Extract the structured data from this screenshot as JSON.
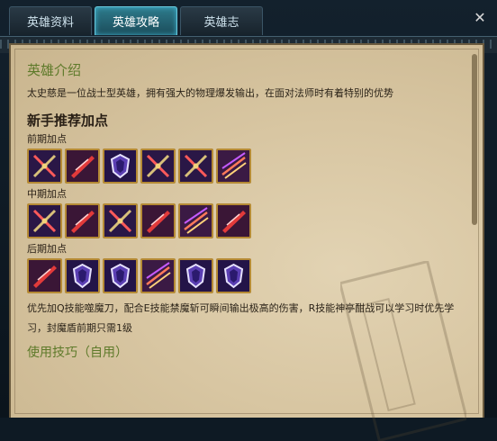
{
  "tabs": [
    {
      "label": "英雄资料",
      "active": false
    },
    {
      "label": "英雄攻略",
      "active": true
    },
    {
      "label": "英雄志",
      "active": false
    }
  ],
  "intro": {
    "title": "英雄介绍",
    "text": "太史慈是一位战士型英雄，拥有强大的物理爆发输出，在面对法师时有着特别的优势"
  },
  "skills_section": {
    "title": "新手推荐加点",
    "phases": [
      {
        "label": "前期加点",
        "icons": [
          "cross-sword-skill-icon",
          "slash-skill-icon",
          "shield-skill-icon",
          "cross-sword-skill-icon",
          "cross-sword-skill-icon",
          "double-blade-skill-icon"
        ]
      },
      {
        "label": "中期加点",
        "icons": [
          "cross-sword-skill-icon",
          "slash-skill-icon",
          "cross-sword-skill-icon",
          "slash-skill-icon",
          "double-blade-skill-icon",
          "slash-skill-icon"
        ]
      },
      {
        "label": "后期加点",
        "icons": [
          "slash-skill-icon",
          "shield-skill-icon",
          "shield-skill-icon",
          "double-blade-skill-icon",
          "shield-skill-icon",
          "shield-skill-icon"
        ]
      }
    ],
    "tip": "优先加Q技能噬魔刀，配合E技能禁魔斩可瞬间输出极高的伤害，R技能神亭酣战可以学习时优先学习，封魔盾前期只需1级"
  },
  "usage": {
    "title": "使用技巧（自用）"
  },
  "colors": {
    "accent_green": "#5e7a2a",
    "parchment": "#d8c6a2",
    "tab_active": "#2e7b8c"
  }
}
